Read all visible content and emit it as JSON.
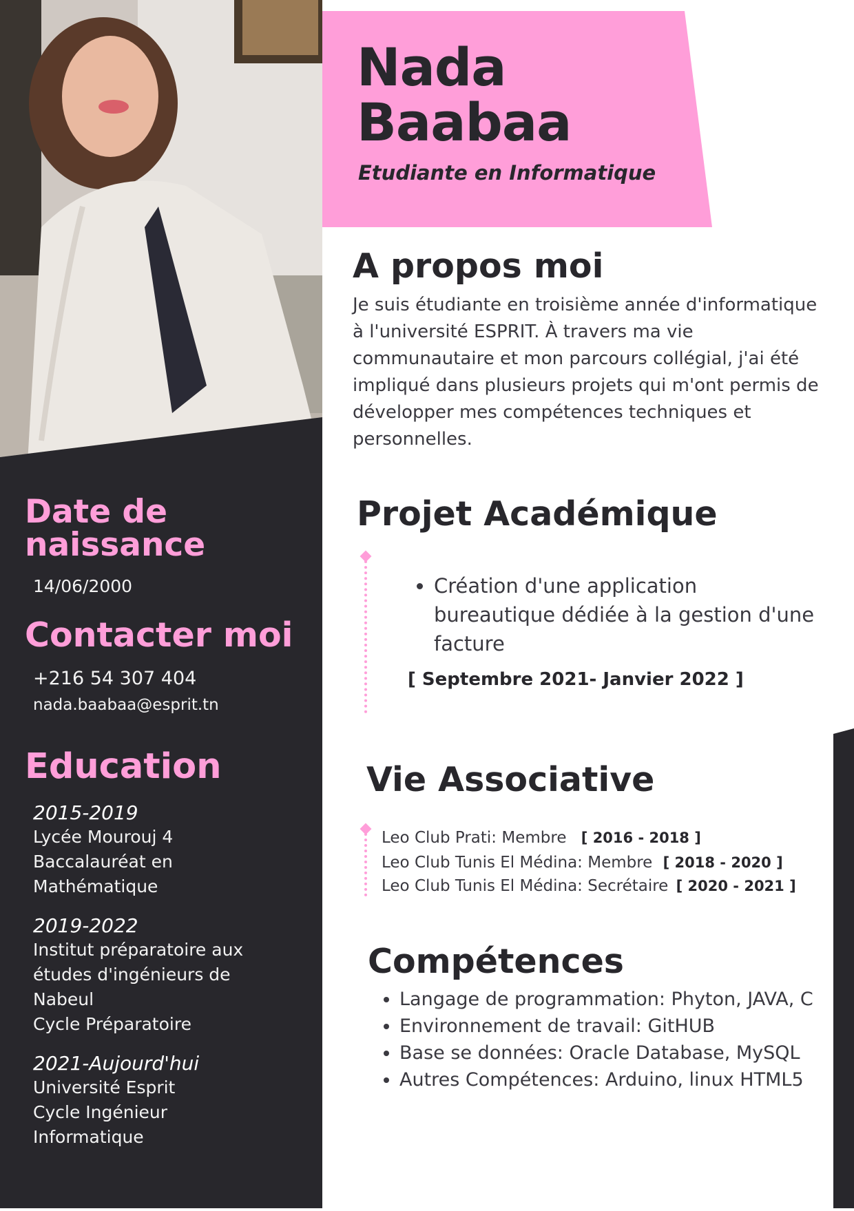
{
  "header": {
    "first_name": "Nada",
    "last_name": "Baabaa",
    "subtitle": "Etudiante en Informatique"
  },
  "colors": {
    "accent_pink": "#ff9ed9",
    "dark": "#28272c",
    "white": "#ffffff"
  },
  "photo": {
    "description_icon": "portrait-photo"
  },
  "sidebar": {
    "birth": {
      "heading_line1": "Date de",
      "heading_line2": "naissance",
      "value": "14/06/2000"
    },
    "contact": {
      "heading": "Contacter moi",
      "phone": "+216 54 307 404",
      "email": "nada.baabaa@esprit.tn"
    },
    "education": {
      "heading": "Education",
      "items": [
        {
          "years": "2015-2019",
          "lines": [
            "Lycée Mourouj 4",
            "Baccalauréat en",
            "Mathématique"
          ]
        },
        {
          "years": "2019-2022",
          "lines": [
            "Institut préparatoire aux",
            "études d'ingénieurs de",
            "Nabeul",
            "Cycle Préparatoire"
          ]
        },
        {
          "years": "2021-Aujourd'hui",
          "lines": [
            "Université Esprit",
            "Cycle Ingénieur",
            "Informatique"
          ]
        }
      ]
    }
  },
  "about": {
    "heading": "A propos moi",
    "text": "Je suis étudiante en troisième année d'informatique à l'université ESPRIT. À travers ma vie communautaire et mon parcours collégial, j'ai été impliqué dans plusieurs projets qui m'ont permis de développer mes compétences techniques et personnelles."
  },
  "project": {
    "heading": "Projet Académique",
    "item": "Création d'une application bureautique dédiée à la gestion d'une facture",
    "date": "[ Septembre 2021- Janvier 2022 ]"
  },
  "associative": {
    "heading": "Vie Associative",
    "items": [
      {
        "text": "Leo Club Prati: Membre",
        "date": "[ 2016 - 2018 ]"
      },
      {
        "text": "Leo Club Tunis El Médina: Membre",
        "date": "[ 2018 - 2020 ]"
      },
      {
        "text": "Leo Club Tunis El Médina: Secrétaire",
        "date": "[ 2020 - 2021 ]"
      }
    ]
  },
  "skills": {
    "heading": "Compétences",
    "items": [
      "Langage de programmation: Phyton, JAVA, C",
      "Environnement de travail: GitHUB",
      "Base se données: Oracle Database, MySQL",
      "Autres Compétences: Arduino, linux HTML5"
    ]
  }
}
